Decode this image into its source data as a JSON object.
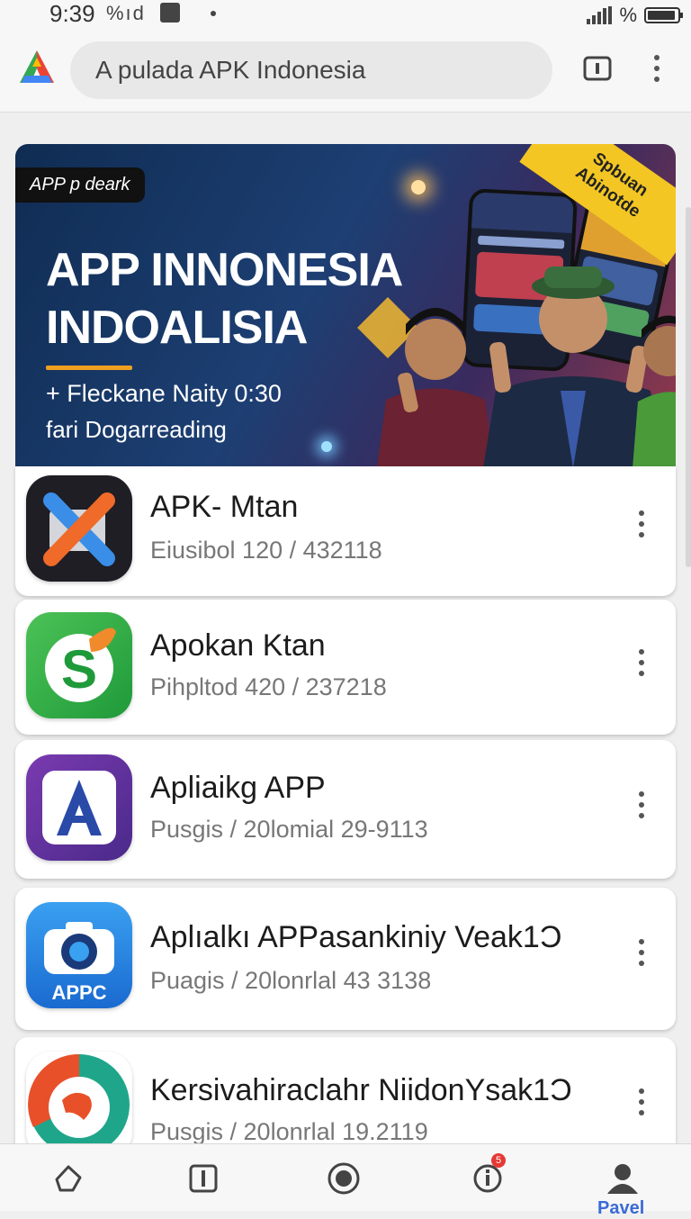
{
  "status_bar": {
    "time": "9:39",
    "icons_text": "%ıd",
    "battery_text": "%"
  },
  "search": {
    "text": "A pulada APK Indonesia"
  },
  "banner": {
    "brand": "APP p deark",
    "title_line1": "APP INNONESIA",
    "title_line2": "INDOALISIA",
    "subtitle1": "+ Fleckane Naity 0:30",
    "subtitle2": "fari Dogarreading",
    "ribbon_line1": "Spbuan",
    "ribbon_line2": "Abinotde"
  },
  "apps": [
    {
      "name": "APK- Mtan",
      "meta": "Eiusibol 120  / 432118",
      "icon": "x-app-icon"
    },
    {
      "name": "Apokan Ktan",
      "meta": "Pihpltod 420 / 237218",
      "icon": "s-leaf-app-icon"
    },
    {
      "name": "Apliaikg APP",
      "meta": "Pusgis  / 20lomial 29-9113",
      "icon": "a-app-icon"
    },
    {
      "name": "Aplıalkı APPasankiniy Veak1Ɔ",
      "meta": "Puagis  / 20lonrlal 43 3138",
      "icon": "camera-app-icon",
      "icon_label": "APPC"
    },
    {
      "name": "Kersivahiraclahr NiidonYsak1Ɔ",
      "meta": "Pusgis  / 20lonrlal 19.2119",
      "icon": "map-app-icon"
    }
  ],
  "bottom_nav": {
    "badge": "5",
    "active_label": "Pavel"
  },
  "colors": {
    "accent": "#3a6ad6",
    "banner_bg": "#1d3f73",
    "ribbon": "#f3c623"
  }
}
